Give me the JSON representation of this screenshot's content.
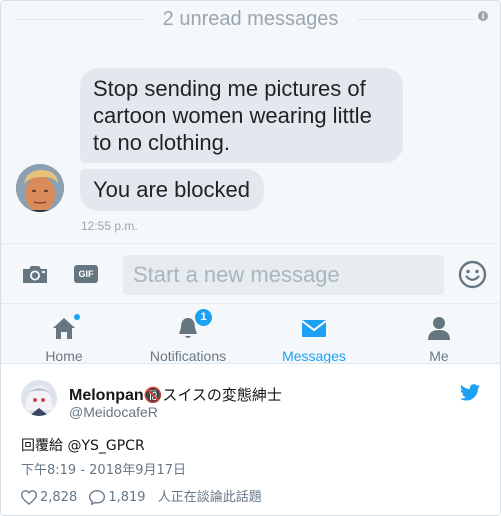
{
  "chat": {
    "unread_banner": "2 unread messages",
    "messages": [
      "Stop sending me pictures of cartoon women wearing little to no clothing.",
      "You are blocked"
    ],
    "timestamp": "12:55 p.m."
  },
  "composer": {
    "gif_label": "GIF",
    "placeholder": "Start a new message"
  },
  "tabs": {
    "home": "Home",
    "notifications": "Notifications",
    "notifications_badge": "1",
    "messages": "Messages",
    "me": "Me",
    "active": "Messages"
  },
  "tweet": {
    "display_name": "Melonpan",
    "name_emoji": "🔞",
    "name_suffix": "スイスの変態紳士",
    "handle": "@MeidocafeR",
    "reply_to": "回覆給 @YS_GPCR",
    "time": "下午8:19 - 2018年9月17日",
    "likes": "2,828",
    "replies": "1,819",
    "talking": "人正在談論此話題"
  },
  "colors": {
    "accent": "#1da1f2",
    "bubble": "#e2e8ed",
    "chat_bg": "#f5f8fa",
    "muted": "#9aa6af"
  },
  "icons": [
    "info-icon",
    "camera-icon",
    "gif-icon",
    "emoji-icon",
    "home-icon",
    "bell-icon",
    "envelope-icon",
    "person-icon",
    "twitter-bird-icon",
    "heart-icon",
    "comment-icon"
  ]
}
